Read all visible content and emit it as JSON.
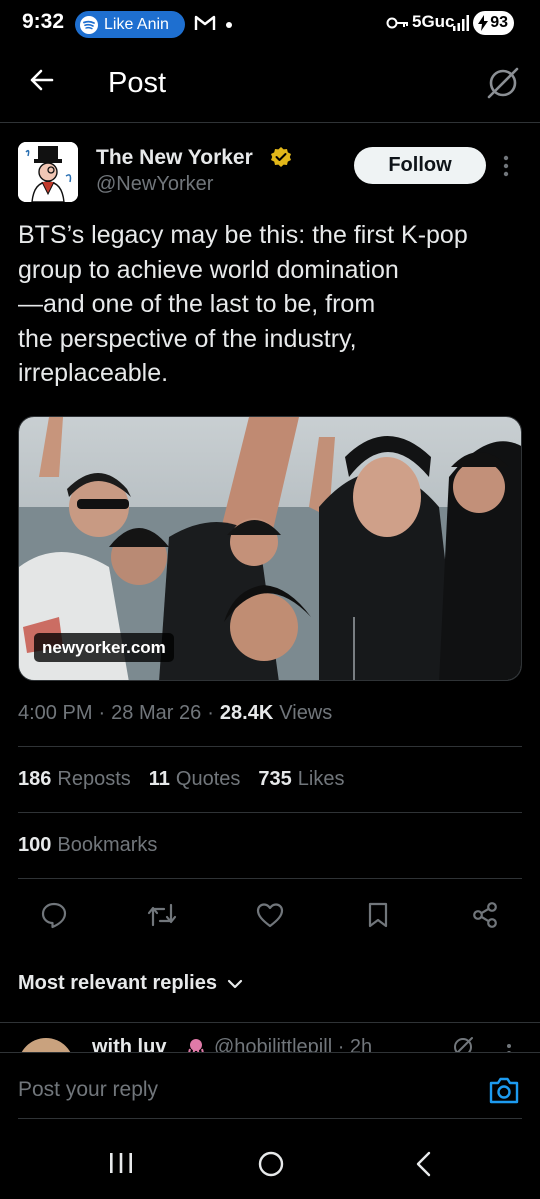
{
  "status_bar": {
    "time": "9:32",
    "media_label": "Like Anin",
    "network": "5Guc",
    "battery": "93"
  },
  "header": {
    "title": "Post"
  },
  "tweet": {
    "author_name": "The New Yorker",
    "author_handle": "@NewYorker",
    "follow_label": "Follow",
    "text": "BTS’s legacy may be this: the first K-pop\ngroup to achieve world domination\n—and one of the last to be, from\nthe perspective of the industry,\nirreplaceable.",
    "media_domain": "newyorker.com",
    "time": "4:00 PM",
    "date": "28 Mar 26",
    "views_count": "28.4K",
    "views_label": "Views",
    "reposts_count": "186",
    "reposts_label": "Reposts",
    "quotes_count": "11",
    "quotes_label": "Quotes",
    "likes_count": "735",
    "likes_label": "Likes",
    "bookmarks_count": "100",
    "bookmarks_label": "Bookmarks"
  },
  "replies": {
    "sort_label": "Most relevant replies",
    "first_reply_name": "with luv",
    "first_reply_handle": "@hobilittlepill · 2h"
  },
  "reply_bar": {
    "placeholder": "Post your reply"
  },
  "colors": {
    "background": "#000000",
    "text_primary": "#e7e9ea",
    "text_secondary": "#71767b",
    "divider": "#2f3336",
    "accent": "#1d9bf0",
    "verified_gold": "#e2b719"
  },
  "icons": [
    "back-arrow-icon",
    "grok-icon",
    "verified-badge-icon",
    "more-icon",
    "reply-icon",
    "repost-icon",
    "like-icon",
    "bookmark-icon",
    "share-icon",
    "chevron-down-icon",
    "camera-icon",
    "recents-icon",
    "home-icon",
    "back-nav-icon"
  ]
}
